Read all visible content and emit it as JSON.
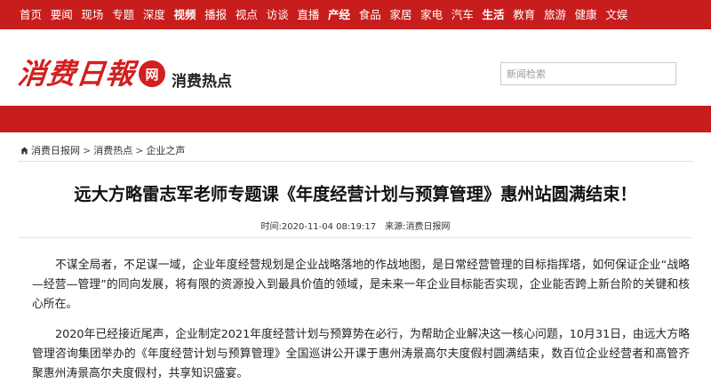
{
  "nav": {
    "items": [
      {
        "label": "首页",
        "bold": false
      },
      {
        "label": "要闻",
        "bold": false
      },
      {
        "label": "现场",
        "bold": false
      },
      {
        "label": "专题",
        "bold": false
      },
      {
        "label": "深度",
        "bold": false
      },
      {
        "label": "视频",
        "bold": true
      },
      {
        "label": "播报",
        "bold": false
      },
      {
        "label": "视点",
        "bold": false
      },
      {
        "label": "访谈",
        "bold": false
      },
      {
        "label": "直播",
        "bold": false
      },
      {
        "label": "产经",
        "bold": true
      },
      {
        "label": "食品",
        "bold": false
      },
      {
        "label": "家居",
        "bold": false
      },
      {
        "label": "家电",
        "bold": false
      },
      {
        "label": "汽车",
        "bold": false
      },
      {
        "label": "生活",
        "bold": true
      },
      {
        "label": "教育",
        "bold": false
      },
      {
        "label": "旅游",
        "bold": false
      },
      {
        "label": "健康",
        "bold": false
      },
      {
        "label": "文娱",
        "bold": false
      }
    ]
  },
  "header": {
    "logo_text": "消费日報",
    "logo_badge": "网",
    "section_title": "消费热点",
    "search_placeholder": "新闻检索"
  },
  "breadcrumb": {
    "items": [
      "消费日报网",
      "消费热点",
      "企业之声"
    ],
    "separator": ">"
  },
  "article": {
    "title": "远大方略雷志军老师专题课《年度经营计划与预算管理》惠州站圆满结束！",
    "time": "时间:2020-11-04 08:19:17",
    "source": "来源:消费日报网",
    "paragraphs": [
      "不谋全局者，不足谋一域，企业年度经营规划是企业战略落地的作战地图，是日常经营管理的目标指挥塔，如何保证企业“战略—经营—管理”的同向发展，将有限的资源投入到最具价值的领域，是未来一年企业目标能否实现，企业能否跨上新台阶的关键和核心所在。",
      "2020年已经接近尾声，企业制定2021年度经营计划与预算势在必行，为帮助企业解决这一核心问题，10月31日，由远大方略管理咨询集团举办的《年度经营计划与预算管理》全国巡讲公开课于惠州涛景高尔夫度假村圆满结束，数百位企业经营者和高管齐聚惠州涛景高尔夫度假村，共享知识盛宴。"
    ]
  },
  "colors": {
    "brand_red": "#c81d1d",
    "logo_red": "#d21f1f"
  }
}
